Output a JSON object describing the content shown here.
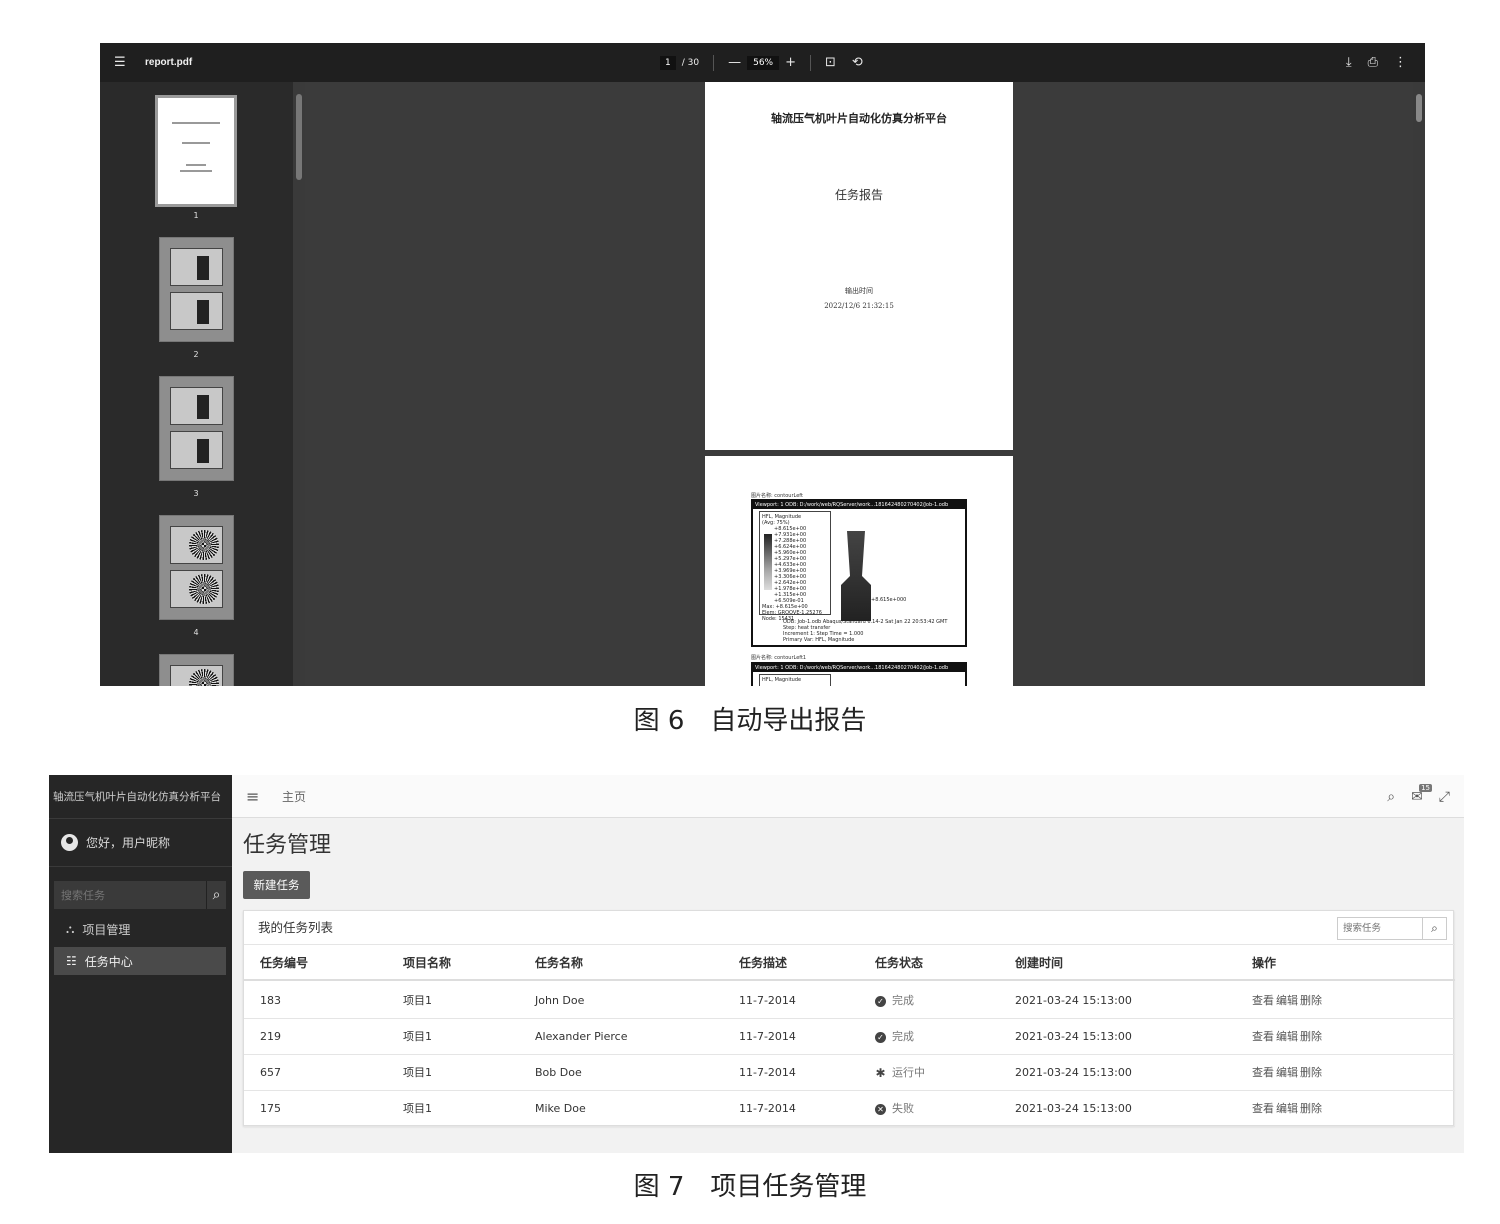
{
  "figure6": {
    "caption": "图 6　自动导出报告",
    "toolbar": {
      "filename": "report.pdf",
      "page_current": "1",
      "page_total": "/ 30",
      "zoom": "56%",
      "zoom_out": "—",
      "zoom_in": "+"
    },
    "thumbnails": [
      "1",
      "2",
      "3",
      "4"
    ],
    "page1": {
      "title": "轴流压气机叶片自动化仿真分析平台",
      "subtitle": "任务报告",
      "time_label": "输出时间",
      "time_value": "2022/12/6 21:32:15"
    },
    "page2": {
      "caption1": "图片名称: contourLeft",
      "frame_header": "Viewport: 1   ODB: D:/work/web/RQServer/work...181642480270402/Job-1.odb",
      "legend": [
        "HFL, Magnitude",
        "(Avg: 75%)",
        "+8.615e+00",
        "+7.931e+00",
        "+7.288e+00",
        "+6.624e+00",
        "+5.960e+00",
        "+5.297e+00",
        "+4.633e+00",
        "+3.969e+00",
        "+3.306e+00",
        "+2.642e+00",
        "+1.978e+00",
        "+1.315e+00",
        "+6.509e-01",
        "Max: +8.615e+00",
        "Elem: GROOVE-1.25276",
        "Node: 15431"
      ],
      "max_label": "+8.615e+000",
      "note": [
        "ODB: Job-1.odb    Abaqus/Standard 6.14-2    Sat Jan 22 20:53:42 GMT",
        "Step: heat transfer",
        "Increment    1: Step Time =    1.000",
        "Primary Var: HFL, Magnitude"
      ],
      "caption2": "图片名称: contourLeft1",
      "legend2": "HFL, Magnitude"
    }
  },
  "figure7": {
    "caption": "图 7　项目任务管理",
    "brand": "轴流压气机叶片自动化仿真分析平台",
    "user_greeting": "您好，用户昵称",
    "sidebar_search_placeholder": "搜索任务",
    "nav": [
      {
        "label": "项目管理",
        "icon": "sitemap-icon"
      },
      {
        "label": "任务中心",
        "icon": "list-icon",
        "active": true
      }
    ],
    "topbar": {
      "home": "主页",
      "badge": "15"
    },
    "page_title": "任务管理",
    "new_task_label": "新建任务",
    "card_title": "我的任务列表",
    "card_search_placeholder": "搜索任务",
    "columns": [
      "任务编号",
      "项目名称",
      "任务名称",
      "任务描述",
      "任务状态",
      "创建时间",
      "操作"
    ],
    "rows": [
      {
        "id": "183",
        "project": "项目1",
        "name": "John Doe",
        "desc": "11-7-2014",
        "status": "完成",
        "status_icon": "check-circle-icon",
        "created": "2021-03-24 15:13:00"
      },
      {
        "id": "219",
        "project": "项目1",
        "name": "Alexander Pierce",
        "desc": "11-7-2014",
        "status": "完成",
        "status_icon": "check-circle-icon",
        "created": "2021-03-24 15:13:00"
      },
      {
        "id": "657",
        "project": "项目1",
        "name": "Bob Doe",
        "desc": "11-7-2014",
        "status": "运行中",
        "status_icon": "running-icon",
        "created": "2021-03-24 15:13:00"
      },
      {
        "id": "175",
        "project": "项目1",
        "name": "Mike Doe",
        "desc": "11-7-2014",
        "status": "失败",
        "status_icon": "x-circle-icon",
        "created": "2021-03-24 15:13:00"
      }
    ],
    "actions": [
      "查看",
      "编辑",
      "删除"
    ]
  }
}
